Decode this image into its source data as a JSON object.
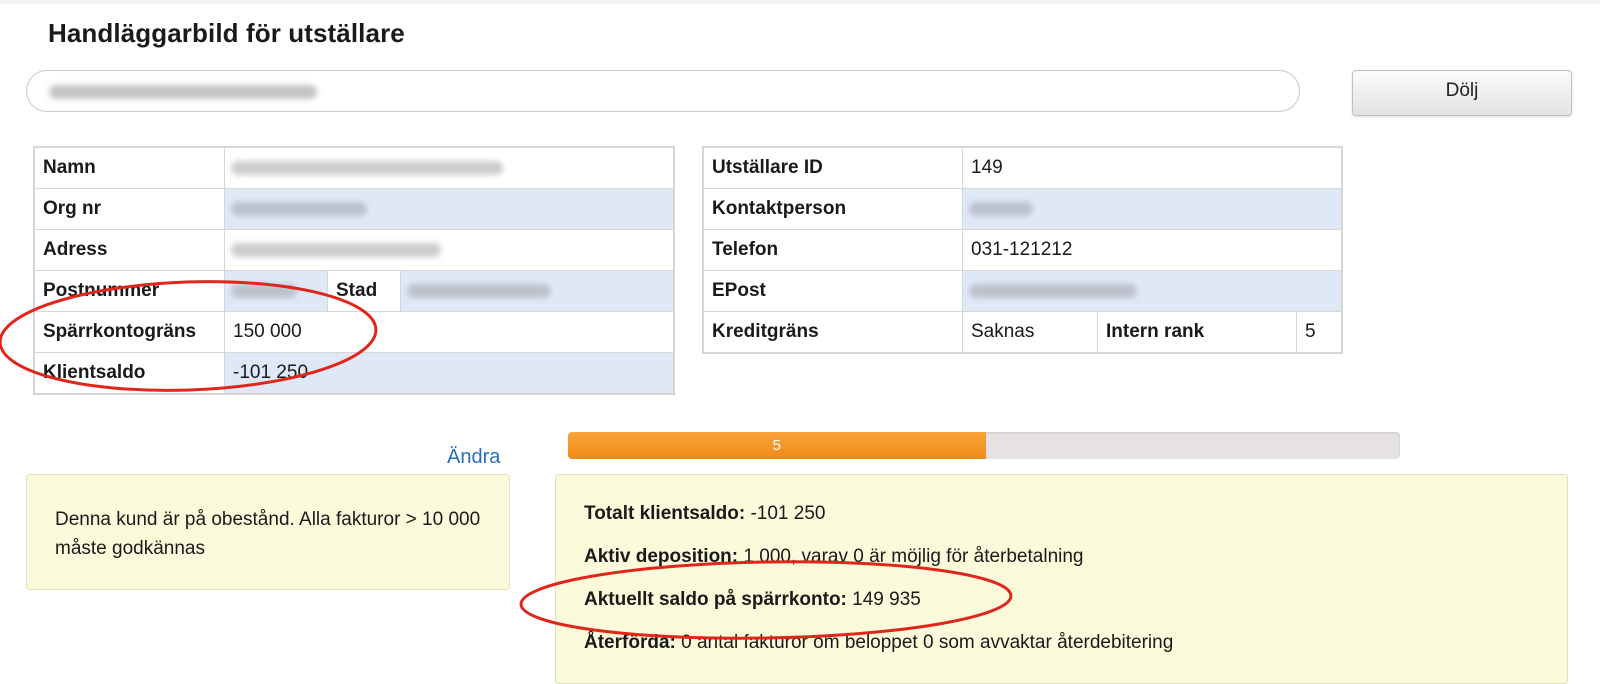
{
  "page": {
    "title": "Handläggarbild för utställare"
  },
  "search": {
    "value": ""
  },
  "toolbar": {
    "hide_label": "Dölj"
  },
  "left_table": {
    "name_label": "Namn",
    "org_label": "Org nr",
    "address_label": "Adress",
    "postal_label": "Postnummer",
    "city_label": "Stad",
    "limit_label": "Spärrkontogräns",
    "limit_value": "150 000",
    "balance_label": "Klientsaldo",
    "balance_value": "-101 250"
  },
  "right_table": {
    "id_label": "Utställare ID",
    "id_value": "149",
    "contact_label": "Kontaktperson",
    "phone_label": "Telefon",
    "phone_value": "031-121212",
    "email_label": "EPost",
    "credit_label": "Kreditgräns",
    "credit_value": "Saknas",
    "rank_label": "Intern rank",
    "rank_value": "5"
  },
  "progress": {
    "label": "5",
    "value_percent": 50.2,
    "fill_color": "#f39321"
  },
  "edit_link": "Ändra",
  "notice": {
    "text": "Denna kund är på obestånd. Alla fakturor > 10 000 måste godkännas"
  },
  "summary": {
    "total_label": "Totalt klientsaldo:",
    "total_value": "-101 250",
    "deposit_label": "Aktiv deposition:",
    "deposit_value": "1 000, varav 0 är möjlig för återbetalning",
    "blocked_label": "Aktuellt saldo på spärrkonto:",
    "blocked_value": "149 935",
    "returned_label": "Återförda:",
    "returned_value": "0 antal fakturor om beloppet 0 som avvaktar återdebitering"
  },
  "colors": {
    "accent": "#f39321",
    "row_highlight": "#dfe8f7",
    "panel_bg": "#fbfbdb",
    "link": "#2a6ebb",
    "annotation": "#e0261b"
  }
}
